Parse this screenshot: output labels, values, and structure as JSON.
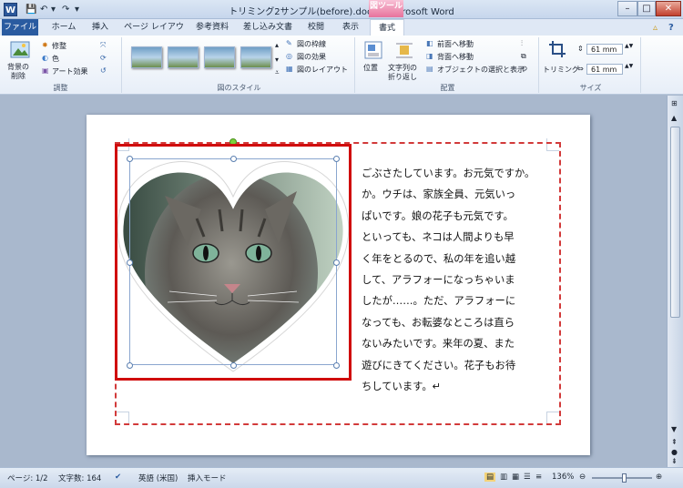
{
  "window": {
    "title": "トリミング2サンプル(before).docx - Microsoft Word",
    "context_label": "図ツール",
    "min_btn": "–",
    "max_btn": "□",
    "close_btn": "✕"
  },
  "qat": {
    "app": "W",
    "undo": "↶",
    "redo": "↷",
    "dropdown": "▾"
  },
  "tabs": [
    "ファイル",
    "ホーム",
    "挿入",
    "ページ レイアウト",
    "参考資料",
    "差し込み文書",
    "校閲",
    "表示",
    "書式"
  ],
  "ribbon": {
    "adjust": {
      "remove_bg": "背景の\n削除",
      "corrections": "修整",
      "color": "色",
      "art_effects": "アート効果",
      "label": "調整"
    },
    "styles": {
      "border": "図の枠線",
      "effects": "図の効果",
      "layout": "図のレイアウト",
      "label": "図のスタイル"
    },
    "arrange": {
      "position": "位置",
      "wrap1": "文字列の",
      "wrap2": "折り返し",
      "bring_forward": "前面へ移動",
      "send_backward": "背面へ移動",
      "selection_pane": "オブジェクトの選択と表示",
      "label": "配置"
    },
    "size": {
      "crop": "トリミング",
      "height": "61 mm",
      "width": "61 mm",
      "label": "サイズ"
    }
  },
  "document": {
    "lines": [
      "ごぶさたしています。お元気ですか。",
      "か。ウチは、家族全員、元気いっ",
      "ぱいです。娘の花子も元気です。",
      "といっても、ネコは人間よりも早",
      "く年をとるので、私の年を追い越",
      "して、アラフォーになっちゃいま",
      "したが……。ただ、アラフォーに",
      "なっても、お転婆なところは直ら",
      "ないみたいです。来年の夏、また",
      "遊びにきてください。花子もお待",
      "ちしています。↵"
    ]
  },
  "status": {
    "page": "ページ: 1/2",
    "words": "文字数: 164",
    "language": "英語 (米国)",
    "mode": "挿入モード",
    "zoom": "136%"
  },
  "colors": {
    "accent": "#2a5ba0",
    "highlight_red": "#d00d0d",
    "dash_red": "#d23a3a"
  }
}
